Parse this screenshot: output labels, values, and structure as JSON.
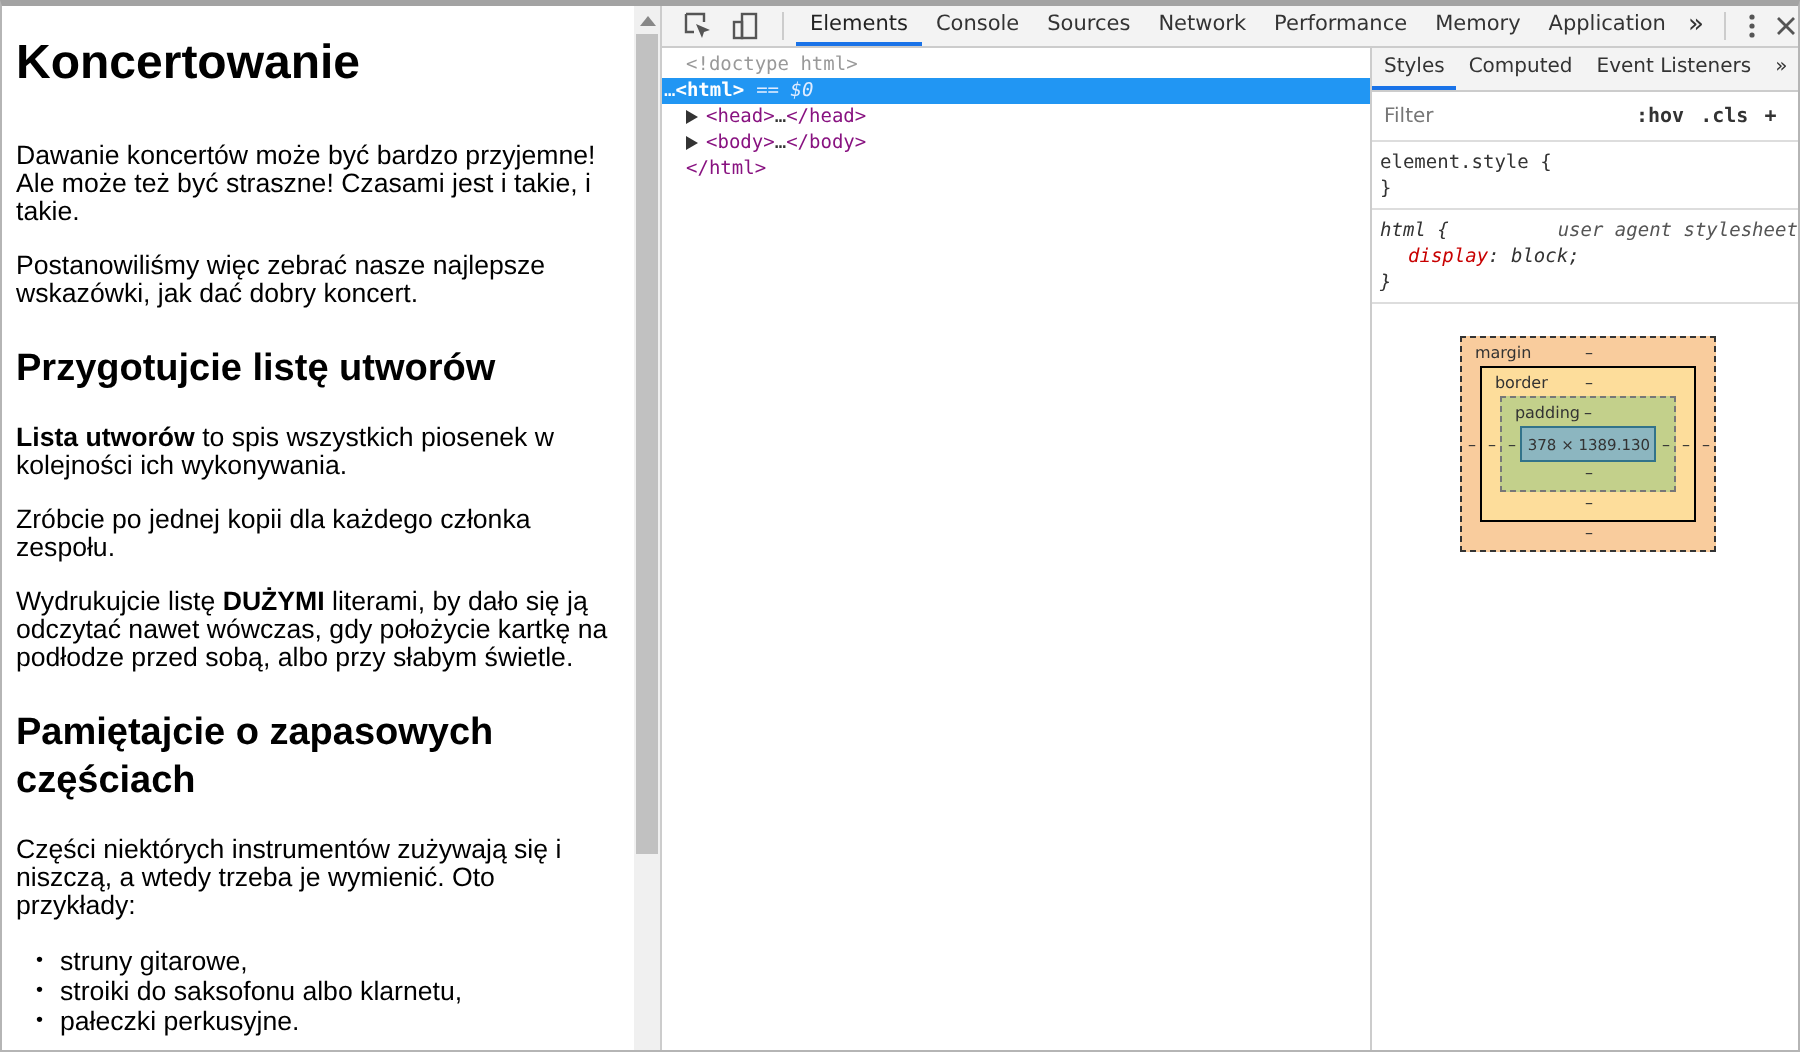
{
  "page": {
    "blocks": [
      {
        "kind": "h1",
        "text": "Koncertowanie"
      },
      {
        "kind": "p",
        "text": "Dawanie koncertów może być bardzo przyjemne! Ale może też być straszne! Czasami jest i takie, i takie."
      },
      {
        "kind": "p",
        "text": "Postanowiliśmy więc zebrać nasze najlepsze wskazówki, jak dać dobry koncert."
      },
      {
        "kind": "h2",
        "text": "Przygotujcie listę utworów"
      },
      {
        "kind": "p",
        "text": "**Lista utworów** to spis wszystkich piosenek w kolejności ich wykonywania."
      },
      {
        "kind": "p",
        "text": "Zróbcie po jednej kopii dla każdego członka zespołu."
      },
      {
        "kind": "p",
        "text": "Wydrukujcie listę **DUŻYMI** literami, by dało się ją odczytać nawet wówczas, gdy położycie kartkę na podłodze przed sobą, albo przy słabym świetle."
      },
      {
        "kind": "h2",
        "text": "Pamiętajcie o zapasowych częściach"
      },
      {
        "kind": "p",
        "text": "Części niektórych instrumentów zużywają się i niszczą, a wtedy trzeba je wymienić. Oto przykłady:"
      },
      {
        "kind": "ul",
        "marker": "•",
        "items": [
          "struny gitarowe,",
          "stroiki do saksofonu albo klarnetu,",
          "pałeczki perkusyjne."
        ]
      }
    ]
  },
  "devtools": {
    "tabs": [
      {
        "label": "Elements",
        "selected": true
      },
      {
        "label": "Console",
        "selected": false
      },
      {
        "label": "Sources",
        "selected": false
      },
      {
        "label": "Network",
        "selected": false
      },
      {
        "label": "Performance",
        "selected": false
      },
      {
        "label": "Memory",
        "selected": false
      },
      {
        "label": "Application",
        "selected": false
      }
    ],
    "tabs_overflow": "»",
    "dom_tree": [
      {
        "kind": "doctype",
        "text": "<!doctype html>",
        "selected": false
      },
      {
        "kind": "open",
        "marker": "…",
        "text": "<html>",
        "note": "== $0",
        "selected": true,
        "children": [
          {
            "kind": "element",
            "open_tag": "<head>",
            "ellipsis": "…",
            "close_tag": "</head>",
            "expanded": false,
            "selected": false
          },
          {
            "kind": "element",
            "open_tag": "<body>",
            "ellipsis": "…",
            "close_tag": "</body>",
            "expanded": false,
            "selected": false
          }
        ]
      },
      {
        "kind": "close",
        "text": "</html>",
        "selected": false
      }
    ],
    "styles": {
      "tabs": [
        {
          "label": "Styles",
          "selected": true
        },
        {
          "label": "Computed",
          "selected": false
        },
        {
          "label": "Event Listeners",
          "selected": false
        }
      ],
      "tabs_overflow": "»",
      "filter": {
        "placeholder": "Filter"
      },
      "buttons": [
        ":hov",
        ".cls",
        "+"
      ],
      "rules": [
        {
          "selector": "element.style {",
          "close": "}"
        },
        {
          "selector": "html {",
          "source": "user agent stylesheet",
          "declarations": [
            {
              "property": "display",
              "separator": ":",
              "value": "block;"
            }
          ],
          "close": "}"
        }
      ]
    },
    "box_model": {
      "margin": {
        "label": "margin",
        "top": "–",
        "right": "–",
        "bottom": "–",
        "left": "–"
      },
      "border": {
        "label": "border",
        "top": "–",
        "right": "–",
        "bottom": "–",
        "left": "–"
      },
      "padding": {
        "label": "padding",
        "top": "–",
        "right": "–",
        "bottom": "–",
        "left": "–"
      },
      "content": "378 × 1389.130"
    }
  }
}
